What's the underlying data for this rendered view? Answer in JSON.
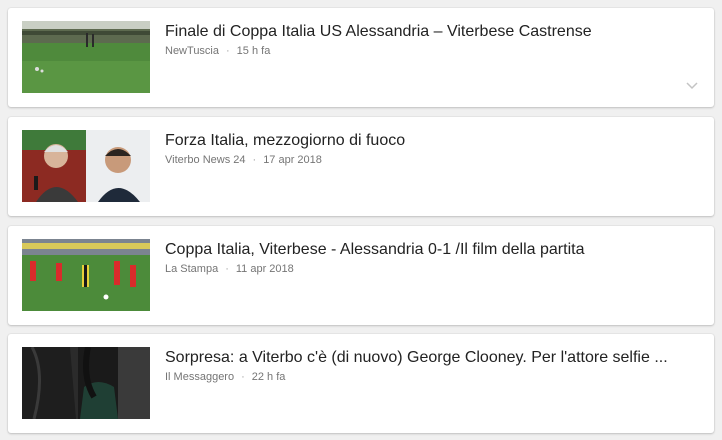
{
  "articles": [
    {
      "title": "Finale di Coppa Italia US Alessandria – Viterbese Castrense",
      "source": "NewTuscia",
      "separator": "·",
      "time": "15 h fa",
      "thumbnail_icon": "football-field-photo"
    },
    {
      "title": "Forza Italia, mezzogiorno di fuoco",
      "source": "Viterbo News 24",
      "separator": "·",
      "time": "17 apr 2018",
      "thumbnail_icon": "politicians-portraits-photo"
    },
    {
      "title": "Coppa Italia, Viterbese - Alessandria 0-1 /Il film della partita",
      "source": "La Stampa",
      "separator": "·",
      "time": "11 apr 2018",
      "thumbnail_icon": "football-match-photo"
    },
    {
      "title": "Sorpresa: a Viterbo c'è (di nuovo) George Clooney. Per l'attore selfie ...",
      "source": "Il Messaggero",
      "separator": "·",
      "time": "22 h fa",
      "thumbnail_icon": "people-photo"
    }
  ],
  "expand_icon": "chevron-down-icon",
  "colors": {
    "background": "#f0f0f0",
    "card": "#ffffff",
    "title": "#222222",
    "meta": "#757575"
  }
}
